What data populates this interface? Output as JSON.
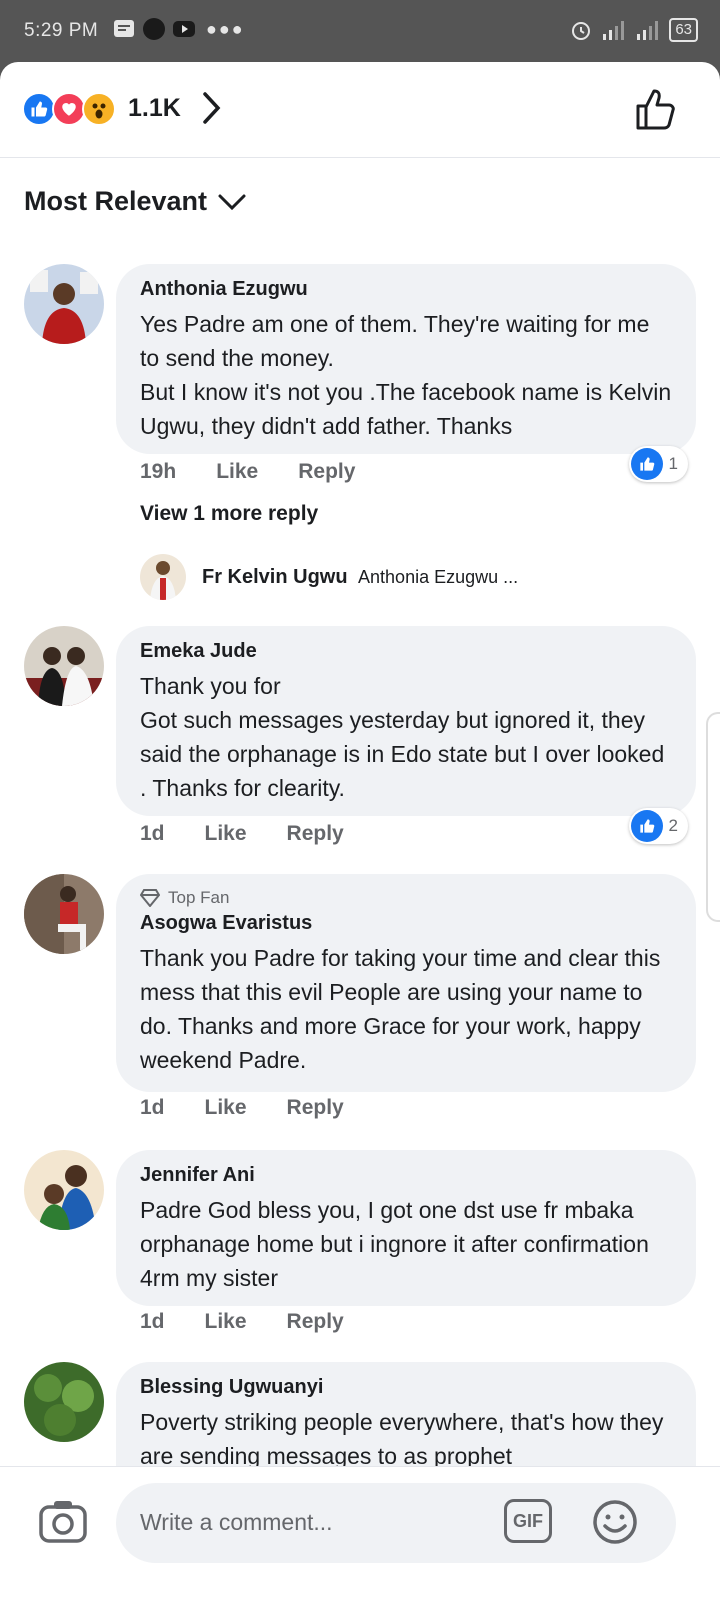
{
  "status_bar": {
    "time": "5:29 PM",
    "battery": "63"
  },
  "reactions": {
    "count": "1.1K",
    "icons": [
      "like-icon",
      "love-icon",
      "wow-icon"
    ]
  },
  "sort": {
    "label": "Most Relevant"
  },
  "comments": [
    {
      "name": "Anthonia Ezugwu",
      "text": "Yes Padre am one of them. They're waiting for me to send the money.\nBut I know it's not you .The facebook name is Kelvin Ugwu, they didn't add father. Thanks",
      "time": "19h",
      "like": "Like",
      "reply": "Reply",
      "likes": "1"
    },
    {
      "name": "Emeka Jude",
      "text": "Thank you for\nGot such messages yesterday but ignored it, they  said the orphanage is in Edo state but I over looked . Thanks for clearity.",
      "time": "1d",
      "like": "Like",
      "reply": "Reply",
      "likes": "2"
    },
    {
      "badge": "Top Fan",
      "name": "Asogwa Evaristus",
      "text": "Thank you Padre for taking your time and clear this mess that this evil People are using your name to do. Thanks and more Grace for your work, happy weekend Padre.",
      "time": "1d",
      "like": "Like",
      "reply": "Reply"
    },
    {
      "name": "Jennifer Ani",
      "text": "Padre God bless you, I got one dst use fr mbaka orphanage home but i ingnore it  after confirmation 4rm my sister",
      "time": "1d",
      "like": "Like",
      "reply": "Reply"
    },
    {
      "name": "Blessing Ugwuanyi",
      "text": "Poverty striking people everywhere, that's how they are sending messages to as prophet"
    }
  ],
  "replies": {
    "view_more": "View 1 more reply",
    "name": "Fr Kelvin Ugwu",
    "snippet": "Anthonia Ezugwu ..."
  },
  "composer": {
    "placeholder": "Write a comment...",
    "gif": "GIF"
  },
  "colors": {
    "accent": "#1877f2",
    "bubble": "#f0f2f5",
    "love": "#f33e58",
    "wow": "#f7b125"
  }
}
